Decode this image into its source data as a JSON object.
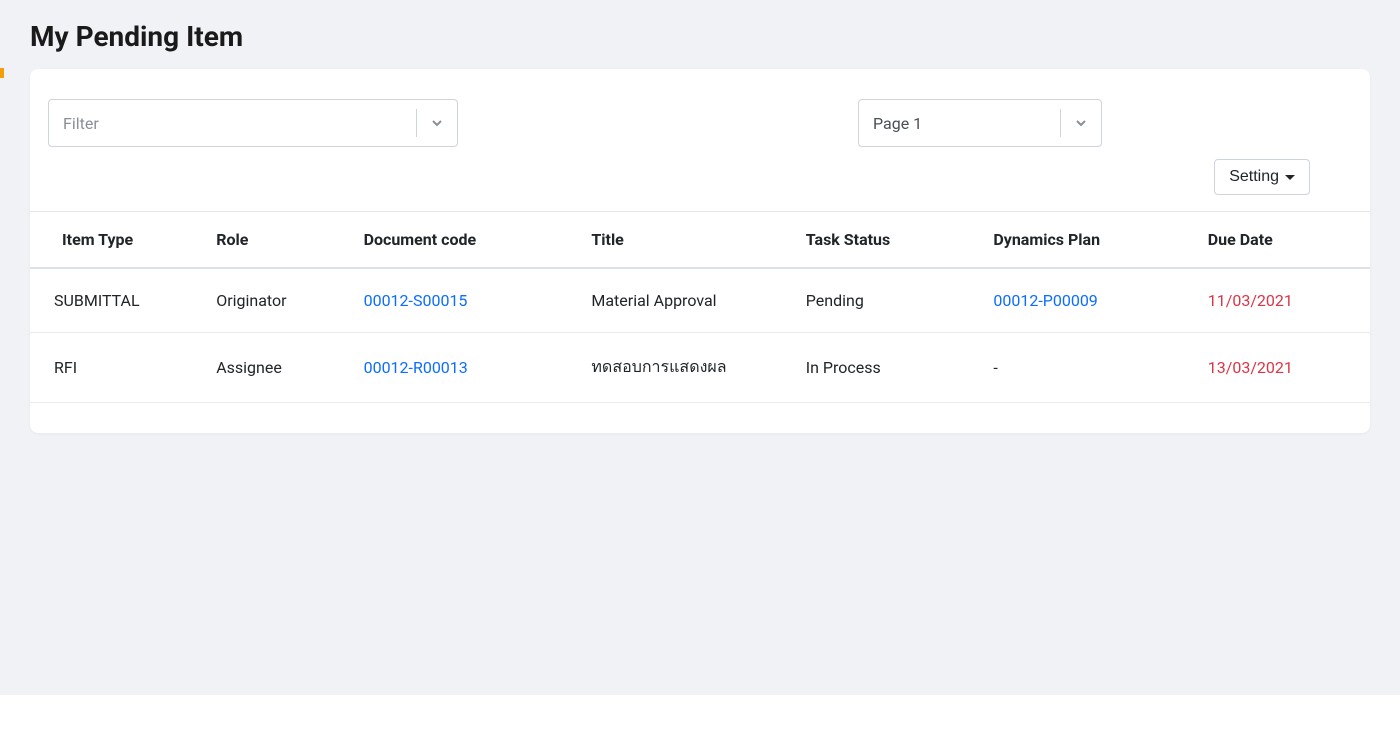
{
  "page_title": "My Pending Item",
  "filter": {
    "placeholder": "Filter"
  },
  "page_select": {
    "value": "Page 1"
  },
  "setting_button": "Setting",
  "table": {
    "headers": {
      "item_type": "Item Type",
      "role": "Role",
      "document_code": "Document code",
      "title": "Title",
      "task_status": "Task Status",
      "dynamics_plan": "Dynamics Plan",
      "due_date": "Due Date"
    },
    "rows": [
      {
        "item_type": "SUBMITTAL",
        "role": "Originator",
        "document_code": "00012-S00015",
        "title": "Material Approval",
        "task_status": "Pending",
        "dynamics_plan": "00012-P00009",
        "dynamics_plan_is_link": true,
        "due_date": "11/03/2021"
      },
      {
        "item_type": "RFI",
        "role": "Assignee",
        "document_code": "00012-R00013",
        "title": "ทดสอบการแสดงผล",
        "task_status": "In Process",
        "dynamics_plan": "-",
        "dynamics_plan_is_link": false,
        "due_date": "13/03/2021"
      }
    ]
  }
}
